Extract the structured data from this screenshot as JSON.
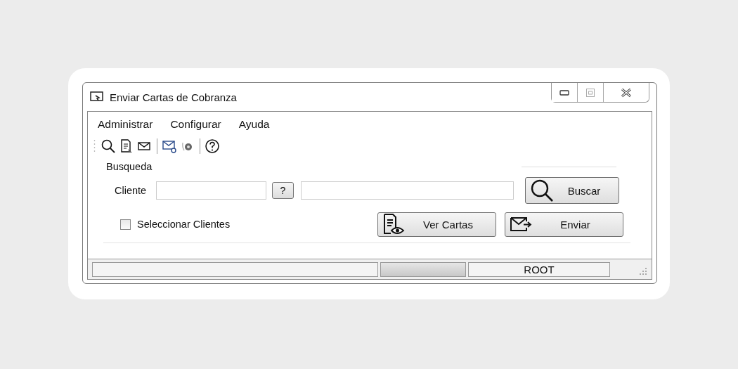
{
  "window": {
    "title": "Enviar Cartas de Cobranza"
  },
  "menu": [
    "Administrar",
    "Configurar",
    "Ayuda"
  ],
  "search_group": {
    "title": "Busqueda",
    "client_label": "Cliente",
    "lookup_button": "?",
    "search_button": "Buscar"
  },
  "select_clients": {
    "label": "Seleccionar Clientes",
    "checked": false
  },
  "buttons": [
    {
      "label": "Ver Cartas",
      "kind": "view"
    },
    {
      "label": "Enviar",
      "kind": "send"
    }
  ],
  "status_bar": {
    "progress": {
      "level": 0
    },
    "user": "ROOT"
  }
}
